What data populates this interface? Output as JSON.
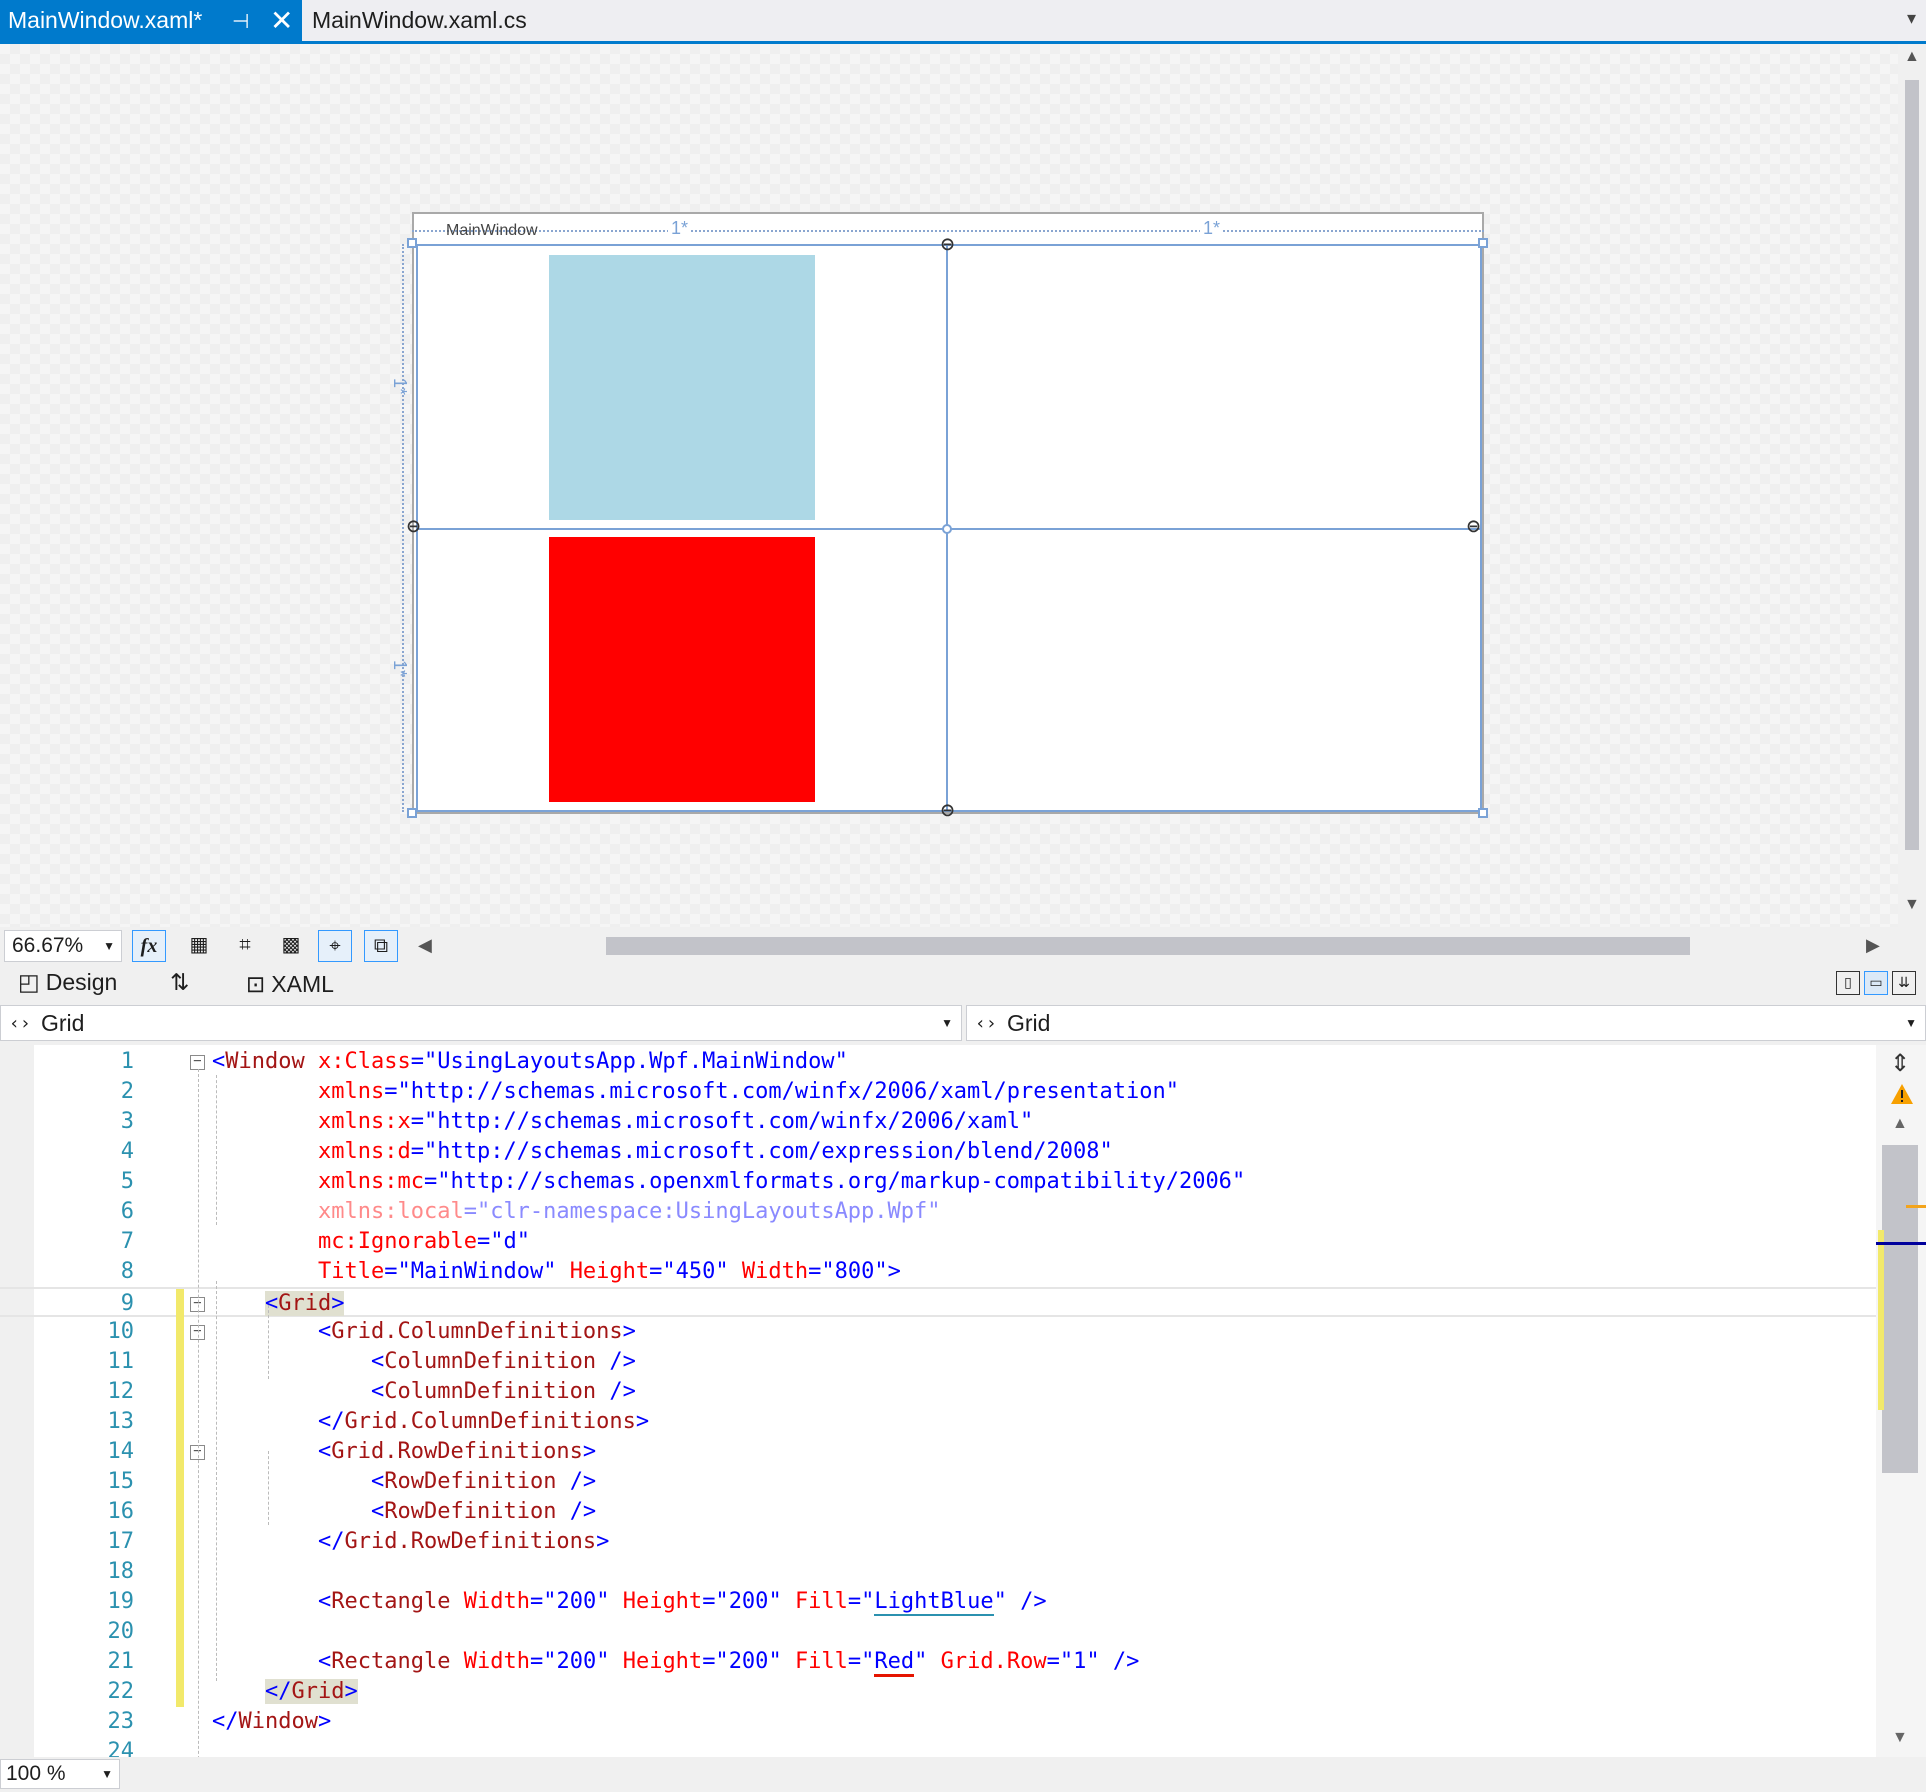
{
  "tabs": {
    "active_label": "MainWindow.xaml*",
    "inactive_label": "MainWindow.xaml.cs",
    "pin_glyph": "⊣",
    "close_glyph": "✕",
    "overflow_glyph": "▾"
  },
  "designer": {
    "window_title": "MainWindow",
    "column_sizes": [
      "1*",
      "1*"
    ],
    "row_sizes": [
      "1*",
      "1*"
    ],
    "rect_fill_1": "#ADD8E6",
    "rect_fill_2": "#FF0000"
  },
  "designer_toolbar": {
    "zoom_value": "66.67%",
    "buttons": [
      {
        "name": "formula-button",
        "glyph": "fx"
      },
      {
        "name": "grid-button",
        "glyph": "▦"
      },
      {
        "name": "snap-gridlines-button",
        "glyph": "⌗"
      },
      {
        "name": "artboard-background-button",
        "glyph": "▩"
      },
      {
        "name": "snap-snaplines-button",
        "glyph": "⌖"
      },
      {
        "name": "effects-button",
        "glyph": "⧉"
      }
    ]
  },
  "split": {
    "design_label": "Design",
    "design_icon": "◰",
    "swap_icon": "⇅",
    "xaml_label": "XAML",
    "xaml_icon": "⊡"
  },
  "navbar": {
    "left_value": "Grid",
    "right_value": "Grid",
    "icon": "‹›"
  },
  "editor": {
    "zoom_value": "100 %",
    "lines": [
      {
        "n": "1",
        "fold": true,
        "indent": 0,
        "tokens": [
          [
            "brk",
            "<"
          ],
          [
            "tag",
            "Window"
          ],
          [
            "plain",
            " "
          ],
          [
            "attr",
            "x:Class"
          ],
          [
            "brk",
            "=\""
          ],
          [
            "val",
            "UsingLayoutsApp.Wpf.MainWindow"
          ],
          [
            "brk",
            "\""
          ]
        ]
      },
      {
        "n": "2",
        "fold": false,
        "indent": 8,
        "tokens": [
          [
            "attr",
            "xmlns"
          ],
          [
            "brk",
            "=\""
          ],
          [
            "val",
            "http://schemas.microsoft.com/winfx/2006/xaml/presentation"
          ],
          [
            "brk",
            "\""
          ]
        ]
      },
      {
        "n": "3",
        "fold": false,
        "indent": 8,
        "tokens": [
          [
            "attr",
            "xmlns:x"
          ],
          [
            "brk",
            "=\""
          ],
          [
            "val",
            "http://schemas.microsoft.com/winfx/2006/xaml"
          ],
          [
            "brk",
            "\""
          ]
        ]
      },
      {
        "n": "4",
        "fold": false,
        "indent": 8,
        "tokens": [
          [
            "attr",
            "xmlns:d"
          ],
          [
            "brk",
            "=\""
          ],
          [
            "val",
            "http://schemas.microsoft.com/expression/blend/2008"
          ],
          [
            "brk",
            "\""
          ]
        ]
      },
      {
        "n": "5",
        "fold": false,
        "indent": 8,
        "tokens": [
          [
            "attr",
            "xmlns:mc"
          ],
          [
            "brk",
            "=\""
          ],
          [
            "val",
            "http://schemas.openxmlformats.org/markup-compatibility/2006"
          ],
          [
            "brk",
            "\""
          ]
        ]
      },
      {
        "n": "6",
        "fold": false,
        "indent": 8,
        "tokens": [
          [
            "dim",
            "xmlns:local"
          ],
          [
            "dimval",
            "=\"clr-namespace:UsingLayoutsApp.Wpf\""
          ]
        ]
      },
      {
        "n": "7",
        "fold": false,
        "indent": 8,
        "tokens": [
          [
            "attr",
            "mc:Ignorable"
          ],
          [
            "brk",
            "=\""
          ],
          [
            "val",
            "d"
          ],
          [
            "brk",
            "\""
          ]
        ]
      },
      {
        "n": "8",
        "fold": false,
        "indent": 8,
        "tokens": [
          [
            "attr",
            "Title"
          ],
          [
            "brk",
            "=\""
          ],
          [
            "val",
            "MainWindow"
          ],
          [
            "brk",
            "\""
          ],
          [
            "plain",
            " "
          ],
          [
            "attr",
            "Height"
          ],
          [
            "brk",
            "=\""
          ],
          [
            "val",
            "450"
          ],
          [
            "brk",
            "\""
          ],
          [
            "plain",
            " "
          ],
          [
            "attr",
            "Width"
          ],
          [
            "brk",
            "=\""
          ],
          [
            "val",
            "800"
          ],
          [
            "brk",
            "\">"
          ]
        ]
      },
      {
        "n": "9",
        "fold": true,
        "changed": true,
        "current": true,
        "indent": 4,
        "tokens": [
          [
            "hlbrk",
            "<"
          ],
          [
            "hltag",
            "Grid"
          ],
          [
            "hlbrk",
            ">"
          ]
        ]
      },
      {
        "n": "10",
        "fold": true,
        "changed": true,
        "indent": 8,
        "tokens": [
          [
            "brk",
            "<"
          ],
          [
            "tag",
            "Grid.ColumnDefinitions"
          ],
          [
            "brk",
            ">"
          ]
        ]
      },
      {
        "n": "11",
        "fold": false,
        "changed": true,
        "indent": 12,
        "tokens": [
          [
            "brk",
            "<"
          ],
          [
            "tag",
            "ColumnDefinition"
          ],
          [
            "plain",
            " "
          ],
          [
            "brk",
            "/>"
          ]
        ]
      },
      {
        "n": "12",
        "fold": false,
        "changed": true,
        "indent": 12,
        "tokens": [
          [
            "brk",
            "<"
          ],
          [
            "tag",
            "ColumnDefinition"
          ],
          [
            "plain",
            " "
          ],
          [
            "brk",
            "/>"
          ]
        ]
      },
      {
        "n": "13",
        "fold": false,
        "changed": true,
        "indent": 8,
        "tokens": [
          [
            "brk",
            "</"
          ],
          [
            "tag",
            "Grid.ColumnDefinitions"
          ],
          [
            "brk",
            ">"
          ]
        ]
      },
      {
        "n": "14",
        "fold": true,
        "changed": true,
        "indent": 8,
        "tokens": [
          [
            "brk",
            "<"
          ],
          [
            "tag",
            "Grid.RowDefinitions"
          ],
          [
            "brk",
            ">"
          ]
        ]
      },
      {
        "n": "15",
        "fold": false,
        "changed": true,
        "indent": 12,
        "tokens": [
          [
            "brk",
            "<"
          ],
          [
            "tag",
            "RowDefinition"
          ],
          [
            "plain",
            " "
          ],
          [
            "brk",
            "/>"
          ]
        ]
      },
      {
        "n": "16",
        "fold": false,
        "changed": true,
        "indent": 12,
        "tokens": [
          [
            "brk",
            "<"
          ],
          [
            "tag",
            "RowDefinition"
          ],
          [
            "plain",
            " "
          ],
          [
            "brk",
            "/>"
          ]
        ]
      },
      {
        "n": "17",
        "fold": false,
        "changed": true,
        "indent": 8,
        "tokens": [
          [
            "brk",
            "</"
          ],
          [
            "tag",
            "Grid.RowDefinitions"
          ],
          [
            "brk",
            ">"
          ]
        ]
      },
      {
        "n": "18",
        "fold": false,
        "changed": true,
        "indent": 0,
        "tokens": []
      },
      {
        "n": "19",
        "fold": false,
        "changed": true,
        "indent": 8,
        "tokens": [
          [
            "brk",
            "<"
          ],
          [
            "tag",
            "Rectangle"
          ],
          [
            "plain",
            " "
          ],
          [
            "attr",
            "Width"
          ],
          [
            "brk",
            "=\""
          ],
          [
            "val",
            "200"
          ],
          [
            "brk",
            "\""
          ],
          [
            "plain",
            " "
          ],
          [
            "attr",
            "Height"
          ],
          [
            "brk",
            "=\""
          ],
          [
            "val",
            "200"
          ],
          [
            "brk",
            "\""
          ],
          [
            "plain",
            " "
          ],
          [
            "attr",
            "Fill"
          ],
          [
            "brk",
            "=\""
          ],
          [
            "valblue",
            "LightBlue"
          ],
          [
            "brk",
            "\""
          ],
          [
            "plain",
            " "
          ],
          [
            "brk",
            "/>"
          ]
        ]
      },
      {
        "n": "20",
        "fold": false,
        "changed": true,
        "indent": 0,
        "tokens": []
      },
      {
        "n": "21",
        "fold": false,
        "changed": true,
        "indent": 8,
        "tokens": [
          [
            "brk",
            "<"
          ],
          [
            "tag",
            "Rectangle"
          ],
          [
            "plain",
            " "
          ],
          [
            "attr",
            "Width"
          ],
          [
            "brk",
            "=\""
          ],
          [
            "val",
            "200"
          ],
          [
            "brk",
            "\""
          ],
          [
            "plain",
            " "
          ],
          [
            "attr",
            "Height"
          ],
          [
            "brk",
            "=\""
          ],
          [
            "val",
            "200"
          ],
          [
            "brk",
            "\""
          ],
          [
            "plain",
            " "
          ],
          [
            "attr",
            "Fill"
          ],
          [
            "brk",
            "=\""
          ],
          [
            "valred",
            "Red"
          ],
          [
            "brk",
            "\""
          ],
          [
            "plain",
            " "
          ],
          [
            "attr",
            "Grid.Row"
          ],
          [
            "brk",
            "=\""
          ],
          [
            "val",
            "1"
          ],
          [
            "brk",
            "\""
          ],
          [
            "plain",
            " "
          ],
          [
            "brk",
            "/>"
          ]
        ]
      },
      {
        "n": "22",
        "fold": false,
        "changed": true,
        "indent": 4,
        "tokens": [
          [
            "hlbrk",
            "</"
          ],
          [
            "hltag",
            "Grid"
          ],
          [
            "hlbrk",
            ">"
          ]
        ]
      },
      {
        "n": "23",
        "fold": false,
        "indent": 0,
        "tokens": [
          [
            "brk",
            "</"
          ],
          [
            "tag",
            "Window"
          ],
          [
            "brk",
            ">"
          ]
        ]
      },
      {
        "n": "24",
        "fold": false,
        "indent": 0,
        "tokens": []
      }
    ]
  }
}
